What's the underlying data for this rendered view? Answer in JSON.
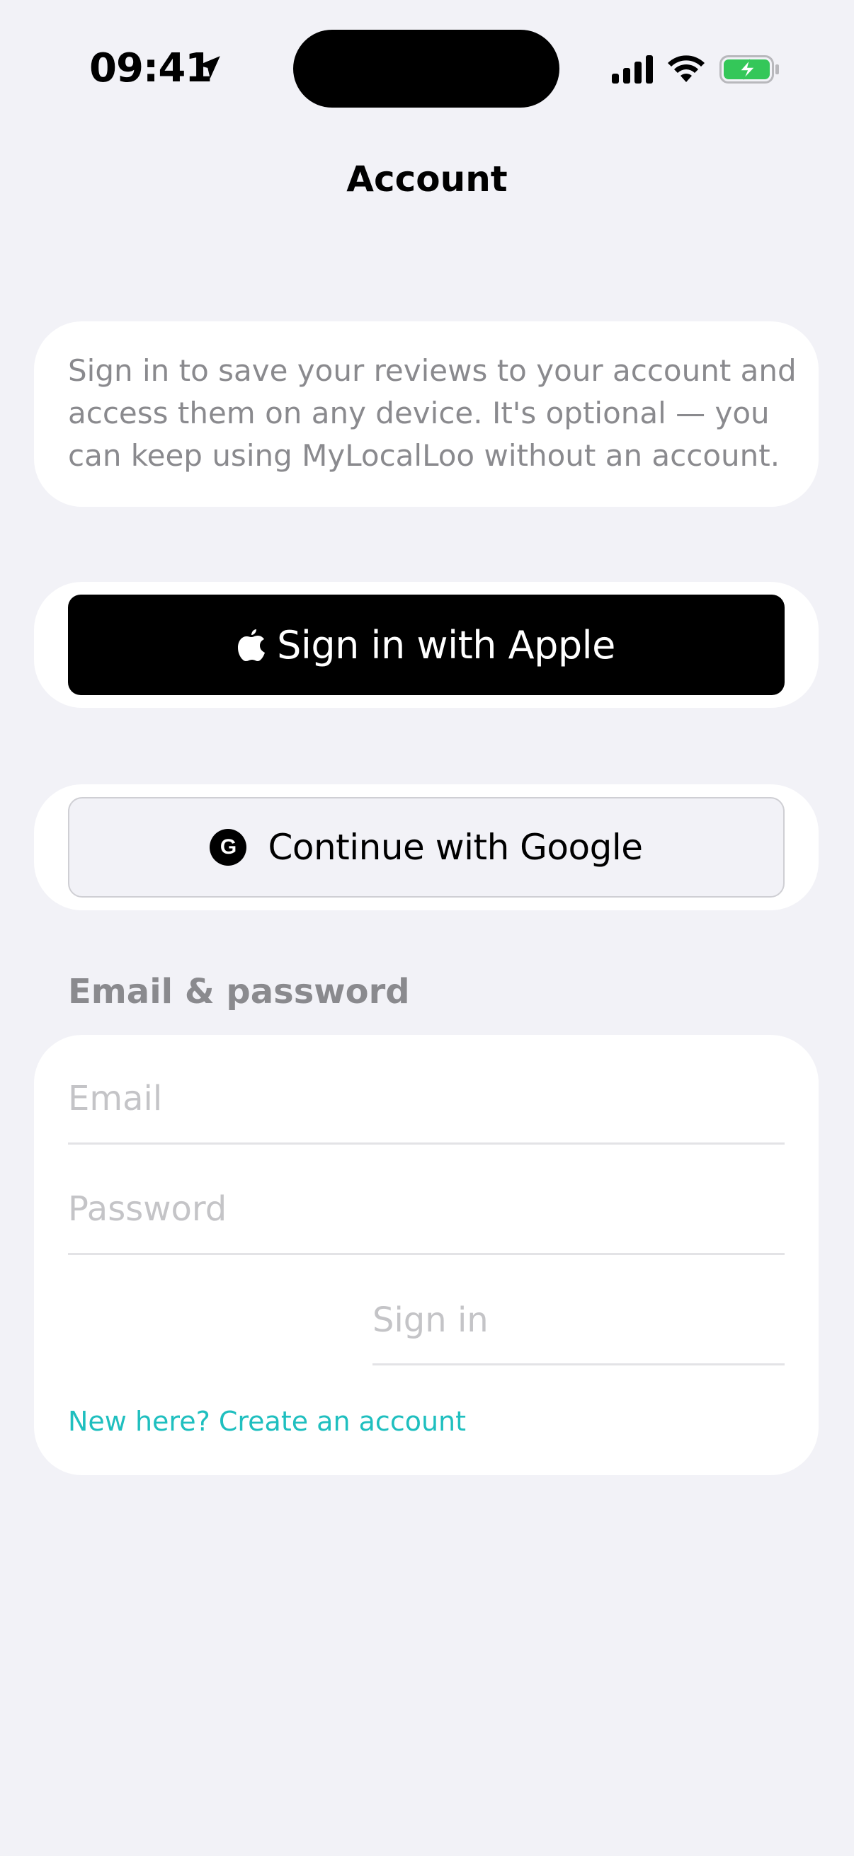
{
  "status_bar": {
    "time": "09:41",
    "icons": [
      "location-arrow-icon",
      "cellular-signal-icon",
      "wifi-icon",
      "battery-charging-icon"
    ],
    "battery_color": "#34c759"
  },
  "nav": {
    "title": "Account"
  },
  "info": {
    "text": "Sign in to save your reviews to your account and access them on any device. It's optional — you can keep using MyLocalLoo without an account."
  },
  "apple": {
    "label": "Sign in with Apple",
    "icon": "apple-logo-icon"
  },
  "google": {
    "label": "Continue with Google",
    "icon_letter": "G"
  },
  "email_section": {
    "header": "Email & password",
    "email_placeholder": "Email",
    "password_placeholder": "Password",
    "sign_in_label": "Sign in",
    "create_account_link": "New here? Create an account"
  },
  "colors": {
    "background": "#f2f2f7",
    "accent_link": "#1fbfbf",
    "secondary_text": "#8a8a8e"
  }
}
